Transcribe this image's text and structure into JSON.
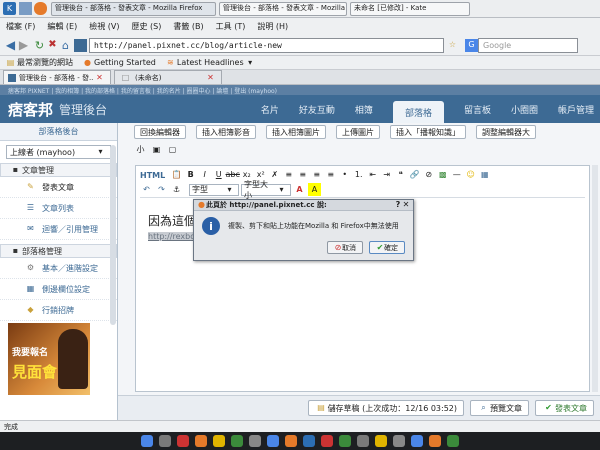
{
  "taskbar": {
    "tasks": [
      "管理後台 - 部落格 - 發表文章 - Mozilla Firefox",
      "管理後台 - 部落格 - 發表文章 - Mozilla ...",
      "未命名 [已修改] - Kate"
    ]
  },
  "menubar": [
    "檔案 (F)",
    "編輯 (E)",
    "檢視 (V)",
    "歷史 (S)",
    "書籤 (B)",
    "工具 (T)",
    "說明 (H)"
  ],
  "navbar": {
    "url": "http://panel.pixnet.cc/blog/article-new",
    "search_placeholder": "Google"
  },
  "bookmarks": [
    "最常瀏覽的網站",
    "Getting Started",
    "Latest Headlines"
  ],
  "tabs": [
    "管理後台 - 部落格 - 發...",
    "(未命名)"
  ],
  "site": {
    "topnav": "痞客邦 PIXNET | 我的相簿 | 我的部落格 | 我的留言板 | 我的名片 | 圈圈中心 | 論壇 | 登出 (mayhoo)",
    "logo": "痞客邦",
    "panel_title": "管理後台",
    "nav": [
      "名片",
      "好友互動",
      "相簿",
      "部落格",
      "留言板",
      "小圈圈",
      "帳戶管理"
    ],
    "nav_active": "部落格"
  },
  "sidebar": {
    "title": "部落格後台",
    "user": "上線者 (mayhoo)",
    "sec1": "文章管理",
    "items1": [
      "發表文章",
      "文章列表",
      "迴響／引用管理"
    ],
    "sec2": "部落格管理",
    "items2": [
      "基本／進階設定",
      "側邊欄位設定",
      "行銷招牌"
    ],
    "ad_text1": "我要報名",
    "ad_text2": "見面會"
  },
  "main": {
    "topbuttons": [
      "回換編輯器",
      "插入相簿影音",
      "插入相簿圖片",
      "上傳圖片",
      "插入「播報知識」",
      "調整編輯器大"
    ],
    "html_label": "HTML",
    "editor_text": "因為這個",
    "editor_text_tail": "！",
    "editor_link": "http://rexboy.",
    "font_select": "字型",
    "size_select": "字型大小"
  },
  "dialog": {
    "title": "此頁於 http://panel.pixnet.cc 說:",
    "message": "複製、剪下和貼上功能在Mozilla 和 Firefox中無法使用",
    "cancel": "取消",
    "ok": "確定"
  },
  "bottombar": {
    "save": "儲存草稿 (上次成功：12/16 03:52)",
    "preview": "預覽文章",
    "publish": "發表文章"
  },
  "status": "完成"
}
